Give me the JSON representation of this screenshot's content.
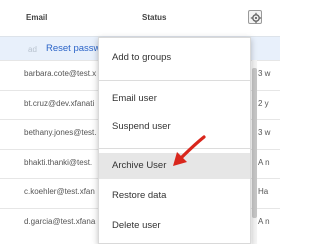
{
  "header": {
    "email_label": "Email",
    "status_label": "Status",
    "settings_icon": "gear-icon"
  },
  "selection": {
    "indicator": "ad",
    "reset_link": "Reset passwo"
  },
  "rows": [
    {
      "email": "barbara.cote@test.x",
      "extra": "3 w"
    },
    {
      "email": "bt.cruz@dev.xfanati",
      "extra": "2 y"
    },
    {
      "email": "bethany.jones@test.",
      "extra": "3 w"
    },
    {
      "email": "bhakti.thanki@test.",
      "extra": "A n"
    },
    {
      "email": "c.koehler@test.xfan",
      "extra": "Ha"
    },
    {
      "email": "d.garcia@test.xfana",
      "extra": "A n"
    }
  ],
  "menu": {
    "items": [
      "Add to groups",
      "Email user",
      "Suspend user",
      "Archive User",
      "Restore data",
      "Delete user"
    ],
    "highlighted_item": "Archive User"
  },
  "colors": {
    "accent_link": "#2b64c8",
    "selection_row": "#e8f0fb",
    "highlight": "#e6e6e6",
    "annotation_arrow": "#d9261c"
  }
}
